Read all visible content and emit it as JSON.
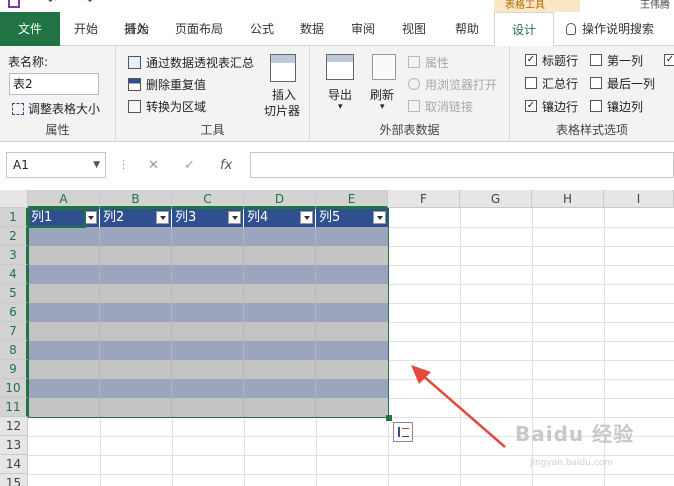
{
  "top": {
    "context_tab_title": "表格工具",
    "user": "王伟腾"
  },
  "tabs": [
    "文件",
    "开始",
    "插入",
    "页面布局",
    "公式",
    "数据",
    "审阅",
    "视图",
    "帮助",
    "设计",
    "操作说明搜索"
  ],
  "ribbon": {
    "properties": {
      "name_label": "表名称:",
      "name_value": "表2",
      "resize_label": "调整表格大小",
      "group_label": "属性"
    },
    "tools": {
      "pivot_label": "通过数据透视表汇总",
      "dedupe_label": "删除重复值",
      "convert_label": "转换为区域",
      "slicer_label_1": "插入",
      "slicer_label_2": "切片器",
      "group_label": "工具"
    },
    "external": {
      "export_label": "导出",
      "refresh_label": "刷新",
      "props_label": "属性",
      "browser_label": "用浏览器打开",
      "unlink_label": "取消链接",
      "group_label": "外部表数据"
    },
    "styles": {
      "options": [
        {
          "label": "标题行",
          "checked": true
        },
        {
          "label": "第一列",
          "checked": false
        },
        {
          "label": "汇总行",
          "checked": false
        },
        {
          "label": "最后一列",
          "checked": false
        },
        {
          "label": "镶边行",
          "checked": true
        },
        {
          "label": "镶边列",
          "checked": false
        }
      ],
      "group_label": "表格样式选项"
    }
  },
  "formula_bar": {
    "cell_ref": "A1",
    "cancel_symbol": "✕",
    "enter_symbol": "✓",
    "fx_symbol": "fx",
    "value": ""
  },
  "sheet": {
    "columns": [
      "A",
      "B",
      "C",
      "D",
      "E",
      "F",
      "G",
      "H",
      "I"
    ],
    "rows": [
      "1",
      "2",
      "3",
      "4",
      "5",
      "6",
      "7",
      "8",
      "9",
      "10",
      "11",
      "12",
      "13",
      "14",
      "15"
    ],
    "table_headers": [
      "列1",
      "列2",
      "列3",
      "列4",
      "列5"
    ]
  },
  "watermark": {
    "brand": "Baidu 经验",
    "url": "jingyan.baidu.com"
  },
  "colors": {
    "excel_green": "#217346",
    "table_header": "#2f4f8f",
    "band": "#9ba6be",
    "plain": "#c4c4c4",
    "annotation_arrow": "#e24a3b"
  }
}
